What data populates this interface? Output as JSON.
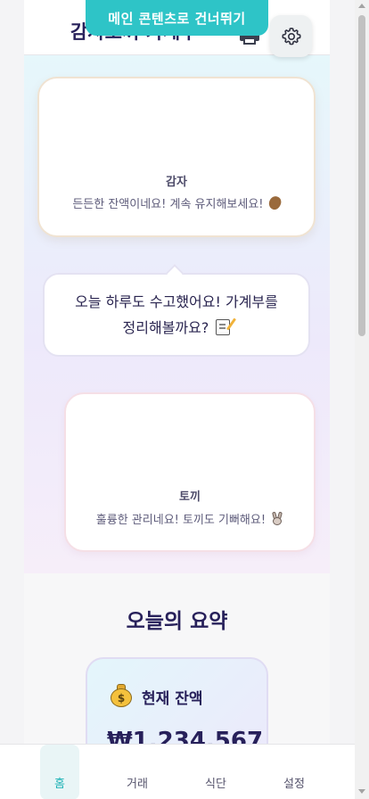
{
  "skip_link": {
    "label": "메인 콘텐츠로 건너뛰기"
  },
  "header": {
    "title": "감자토끼 가계부",
    "print_icon": "printer-icon",
    "settings_icon": "gear-icon"
  },
  "characters": [
    {
      "name": "감자",
      "message": "든든한 잔액이네요! 계속 유지해보세요!",
      "emoji": "potato"
    },
    {
      "name": "토끼",
      "message": "훌륭한 관리네요! 토끼도 기뻐해요!",
      "emoji": "rabbit"
    }
  ],
  "speech_bubble": {
    "line1": "오늘 하루도 수고했어요! 가계부를",
    "line2": "정리해볼까요?",
    "emoji": "memo"
  },
  "summary": {
    "title": "오늘의 요약",
    "balance_label": "현재 잔액",
    "balance_value": "₩1,234,567",
    "balance_icon": "money-bag"
  },
  "nav": [
    {
      "label": "홈",
      "active": true
    },
    {
      "label": "거래",
      "active": false
    },
    {
      "label": "식단",
      "active": false
    },
    {
      "label": "설정",
      "active": false
    }
  ],
  "colors": {
    "accent": "#2ec4c7",
    "title": "#27205a",
    "nav_active": "#22b4b7"
  }
}
